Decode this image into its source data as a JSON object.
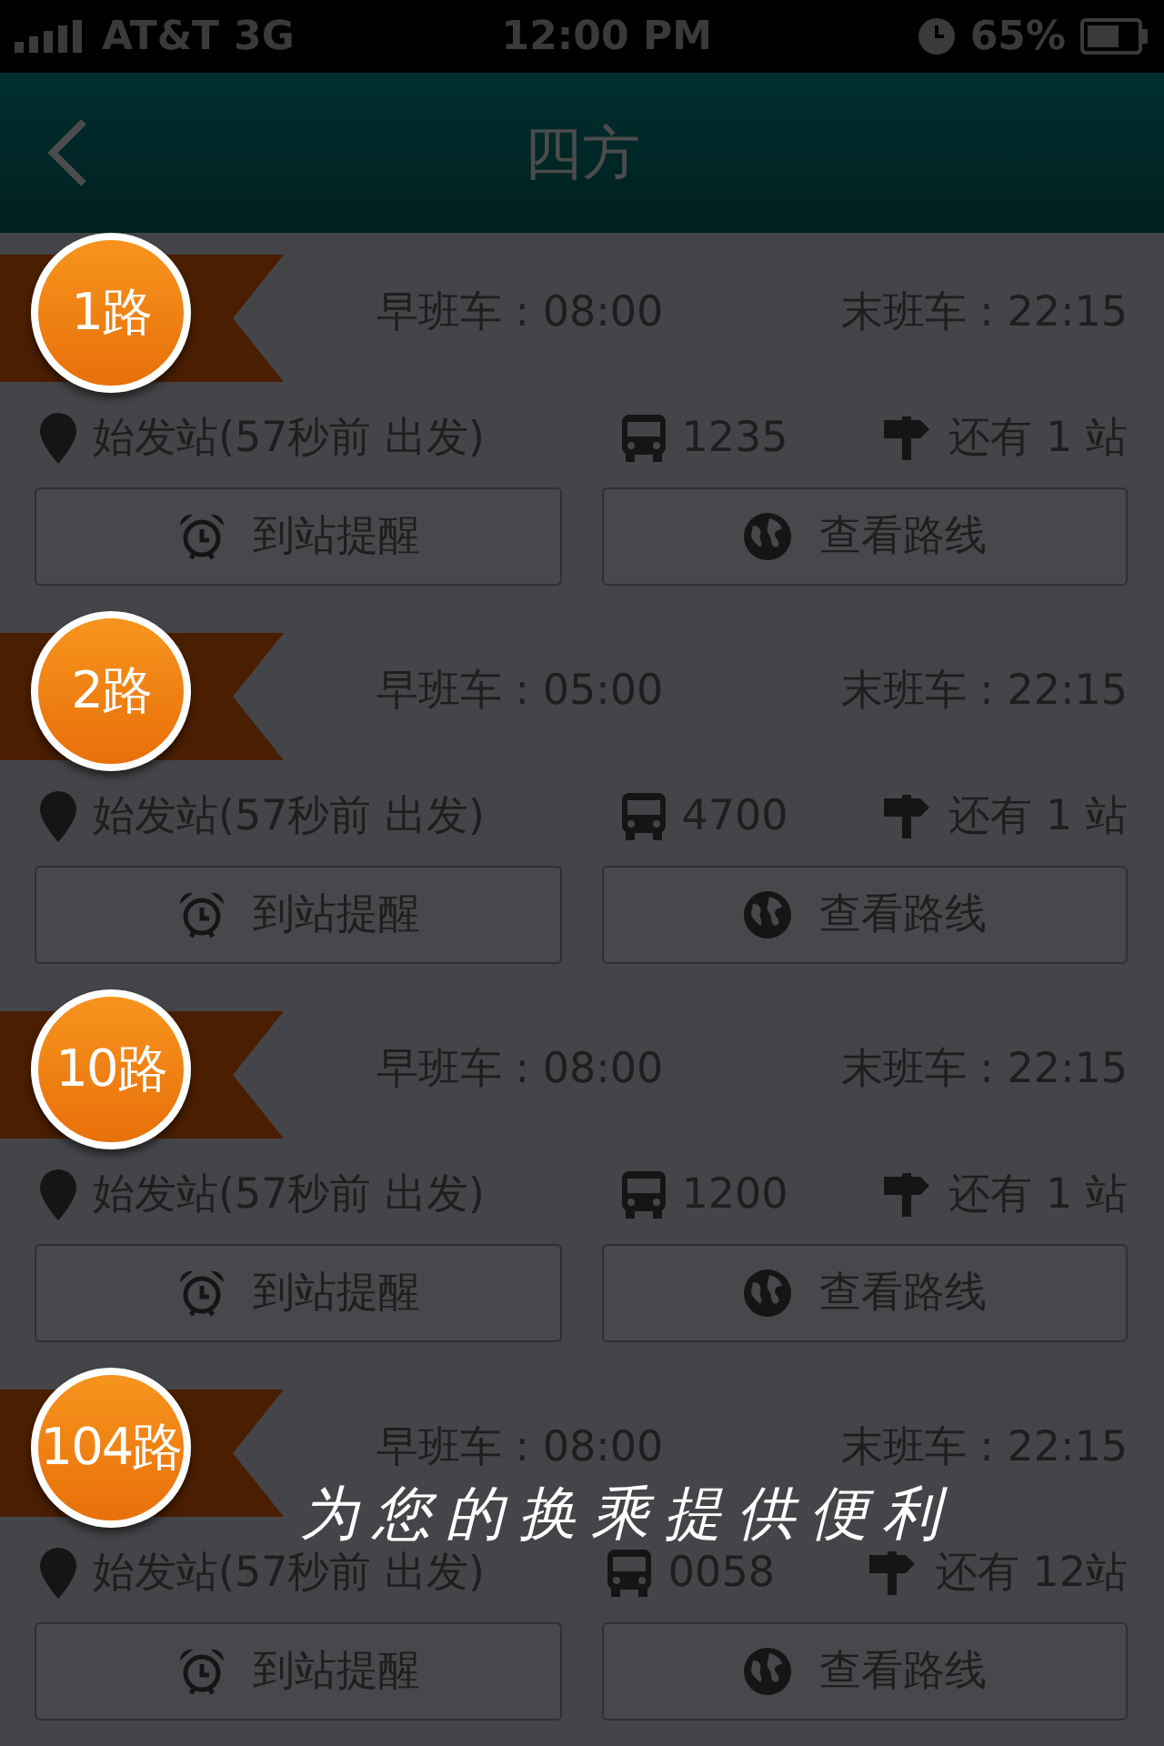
{
  "status_bar": {
    "carrier": "AT&T",
    "network": "3G",
    "time": "12:00 PM",
    "battery": "65%"
  },
  "header": {
    "title": "四方"
  },
  "routes": [
    {
      "route": "1路",
      "first_bus": "早班车 : 08:00",
      "last_bus": "末班车 : 22:15",
      "origin": "始发站(57秒前 出发)",
      "bus_no": "1235",
      "stops_left": "还有 1 站",
      "buttons": [
        "到站提醒",
        "查看路线"
      ]
    },
    {
      "route": "2路",
      "first_bus": "早班车 : 05:00",
      "last_bus": "末班车 : 22:15",
      "origin": "始发站(57秒前 出发)",
      "bus_no": "4700",
      "stops_left": "还有 1 站",
      "buttons": [
        "到站提醒",
        "查看路线"
      ]
    },
    {
      "route": "10路",
      "first_bus": "早班车 : 08:00",
      "last_bus": "末班车 : 22:15",
      "origin": "始发站(57秒前 出发)",
      "bus_no": "1200",
      "stops_left": "还有 1 站",
      "buttons": [
        "到站提醒",
        "查看路线"
      ]
    },
    {
      "route": "104路",
      "first_bus": "早班车 : 08:00",
      "last_bus": "末班车 : 22:15",
      "origin": "始发站(57秒前 出发)",
      "bus_no": "0058",
      "stops_left": "还有 12站",
      "buttons": [
        "到站提醒",
        "查看路线"
      ]
    }
  ],
  "caption": "为您的换乘提供便利"
}
